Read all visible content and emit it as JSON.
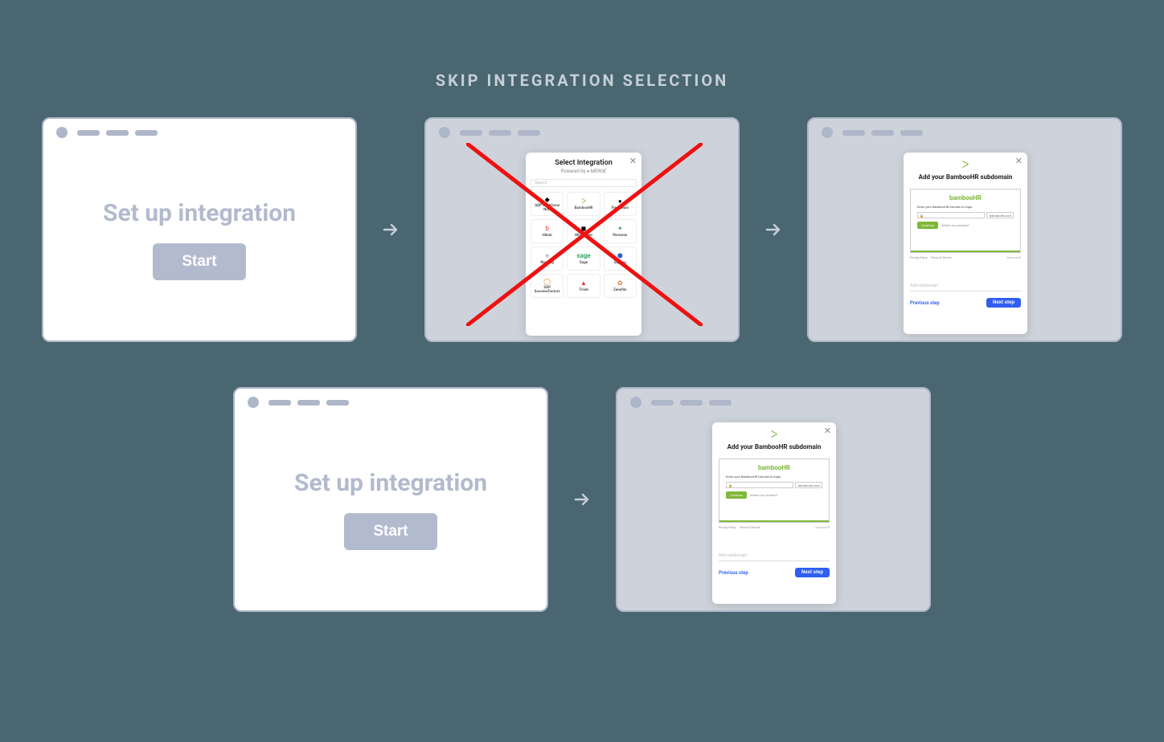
{
  "title": "SKIP INTEGRATION SELECTION",
  "card_setup": {
    "heading": "Set up integration",
    "start": "Start"
  },
  "select_modal": {
    "title": "Select Integration",
    "powered_by": "Powered by ♦ MERGE",
    "search_placeholder": "Search",
    "items": [
      {
        "label": "ADP Workforce Now",
        "icon_color": "#d33"
      },
      {
        "label": "BambooHR",
        "icon_color": "#7fb739"
      },
      {
        "label": "Freshteam",
        "icon_color": "#222"
      },
      {
        "label": "Hibob",
        "icon_color": "#d33"
      },
      {
        "label": "HR Partner",
        "icon_color": "#222"
      },
      {
        "label": "Personio",
        "icon_color": "#3a6"
      },
      {
        "label": "Rippling",
        "icon_color": "#222"
      },
      {
        "label": "Sage",
        "icon_color": "#3a6"
      },
      {
        "label": "Sapling",
        "icon_color": "#2a5ed6"
      },
      {
        "label": "SAP SuccessFactors",
        "icon_color": "#e38b2d"
      },
      {
        "label": "Trinet",
        "icon_color": "#d33"
      },
      {
        "label": "Zenefits",
        "icon_color": "#e07030"
      }
    ]
  },
  "bamboo_modal": {
    "logo_char": "ᐳ",
    "title": "Add your BambooHR subdomain",
    "brand": "bambooHR",
    "instr": "Enter your BambooHR Domain to login.",
    "domain_placeholder": "",
    "domain_suffix": ".bamboohr.com",
    "continue": "Continue",
    "whats_my": "What's my domain?",
    "privacy": "Privacy Policy",
    "terms": "Terms of Service",
    "powered": "bambooHR",
    "sub_input_placeholder": "Add subdomain",
    "previous": "Previous step",
    "next": "Next step"
  }
}
